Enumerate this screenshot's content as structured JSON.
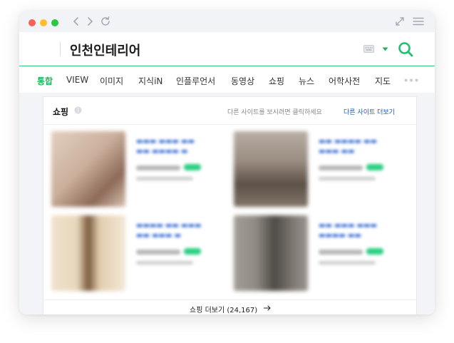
{
  "window": {
    "controls": [
      "close",
      "minimize",
      "zoom"
    ],
    "control_colors": [
      "#fb5f57",
      "#fdbd2e",
      "#2ac840"
    ]
  },
  "search": {
    "query": "인천인테리어",
    "accent_color": "#21b25d"
  },
  "tabs": [
    {
      "label": "통합",
      "active": true
    },
    {
      "label": "VIEW",
      "active": false
    },
    {
      "label": "이미지",
      "active": false
    },
    {
      "label": "지식iN",
      "active": false
    },
    {
      "label": "인플루언서",
      "active": false
    },
    {
      "label": "동영상",
      "active": false
    },
    {
      "label": "쇼핑",
      "active": false
    },
    {
      "label": "뉴스",
      "active": false
    },
    {
      "label": "어학사전",
      "active": false
    },
    {
      "label": "지도",
      "active": false
    }
  ],
  "shopping": {
    "title": "쇼핑",
    "note": "다른 사이트를 보시려면 클릭하세요",
    "link": "다른 사이트 더보기",
    "more_label": "쇼핑 더보기 (24,167)",
    "products": [
      {
        "image_colors": [
          "#d9c2b0",
          "#8d6a58"
        ]
      },
      {
        "image_colors": [
          "#9a8c80",
          "#5c5148"
        ]
      },
      {
        "image_colors": [
          "#e7d7bb",
          "#7a5a3c"
        ]
      },
      {
        "image_colors": [
          "#8f8a84",
          "#4e4a45"
        ]
      }
    ]
  },
  "icons": [
    "back-icon",
    "forward-icon",
    "reload-icon",
    "expand-icon",
    "menu-icon",
    "keyboard-icon",
    "dropdown-icon",
    "search-icon",
    "more-icon",
    "info-icon",
    "arrow-right-icon"
  ]
}
